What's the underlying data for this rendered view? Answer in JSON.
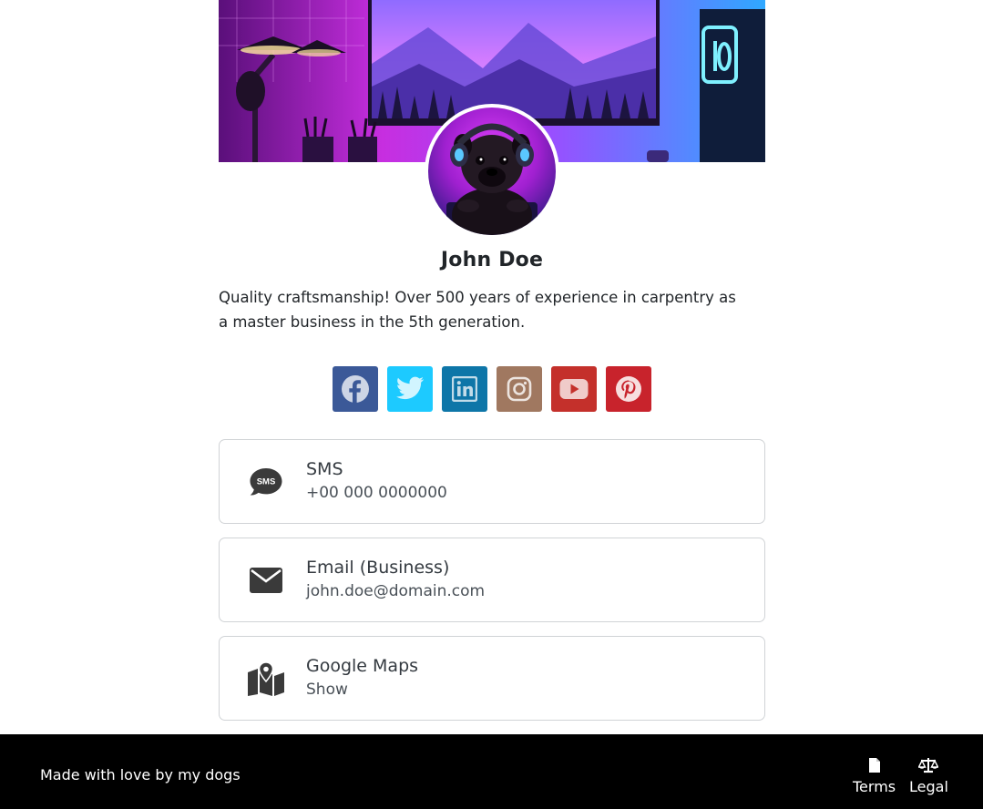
{
  "profile": {
    "name": "John Doe",
    "bio": "Quality craftsmanship! Over 500 years of experience in carpentry as a master business in the 5th generation."
  },
  "socials": [
    {
      "name": "facebook",
      "icon": "facebook-icon",
      "color": "#3b5998"
    },
    {
      "name": "twitter",
      "icon": "twitter-icon",
      "color": "#1dcaff"
    },
    {
      "name": "linkedin",
      "icon": "linkedin-icon",
      "color": "#0e76a8"
    },
    {
      "name": "instagram",
      "icon": "instagram-icon",
      "color": "#a07860"
    },
    {
      "name": "youtube",
      "icon": "youtube-icon",
      "color": "#c4302b"
    },
    {
      "name": "pinterest",
      "icon": "pinterest-icon",
      "color": "#c8232c"
    }
  ],
  "contacts": [
    {
      "title": "SMS",
      "value": "+00 000 0000000",
      "icon": "sms-icon"
    },
    {
      "title": "Email (Business)",
      "value": "john.doe@domain.com",
      "icon": "envelope-icon"
    },
    {
      "title": "Google Maps",
      "value": "Show",
      "icon": "map-icon"
    }
  ],
  "footer": {
    "made_with": "Made with love by my dogs",
    "terms_label": "Terms",
    "legal_label": "Legal"
  }
}
